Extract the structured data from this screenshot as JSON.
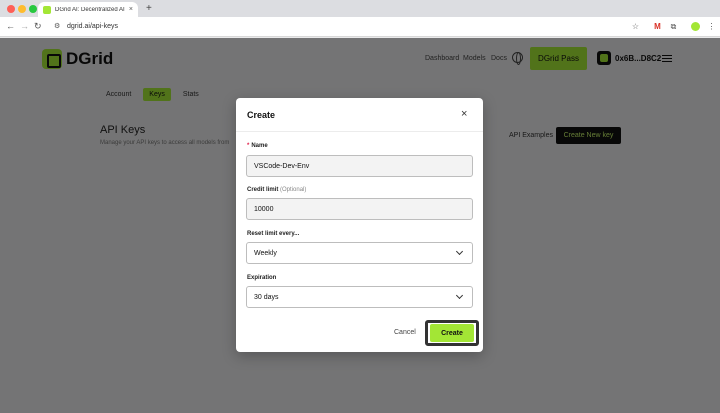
{
  "browser": {
    "tab_title": "DGrid AI: Decentralized AI Inf",
    "tab_close": "×",
    "new_tab": "+",
    "url": "dgrid.ai/api-keys",
    "icons": [
      "back-icon",
      "forward-icon",
      "reload-icon",
      "site-info-icon",
      "star-icon",
      "gmail-icon",
      "extensions-icon",
      "sidepanel-icon",
      "profile-icon",
      "menu-icon"
    ]
  },
  "header": {
    "logo_text": "DGrid",
    "nav": {
      "dashboard": "Dashboard",
      "models": "Models",
      "docs": "Docs"
    },
    "pass_button": "DGrid Pass",
    "wallet_address": "0x6B...D8C2"
  },
  "subtabs": {
    "account": "Account",
    "keys": "Keys",
    "stats": "Stats",
    "active": "Keys"
  },
  "main": {
    "title": "API Keys",
    "description": "Manage your API keys to access all models from",
    "api_examples": "API Examples",
    "create_new_key": "Create New key"
  },
  "modal": {
    "title": "Create",
    "close": "×",
    "name": {
      "required_mark": "*",
      "label": "Name",
      "value": "VSCode-Dev-Env"
    },
    "credit_limit": {
      "label": "Credit limit",
      "optional": "(Optional)",
      "value": "10000"
    },
    "reset_limit": {
      "label": "Reset limit every...",
      "value": "Weekly"
    },
    "expiration": {
      "label": "Expiration",
      "value": "30 days"
    },
    "cancel_label": "Cancel",
    "create_label": "Create"
  },
  "colors": {
    "accent": "#a3e635",
    "dark": "#111111",
    "required": "#e11d48"
  }
}
